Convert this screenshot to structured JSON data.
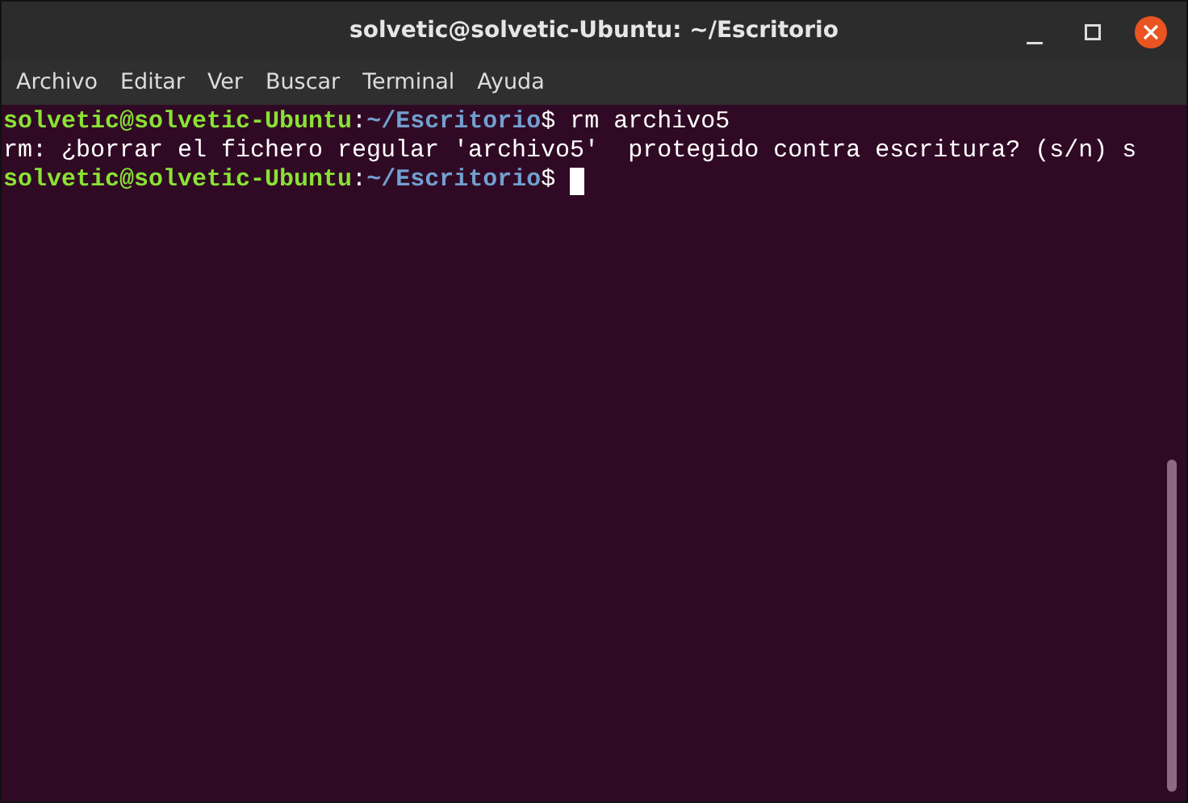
{
  "window": {
    "title": "solvetic@solvetic-Ubuntu: ~/Escritorio"
  },
  "menu": [
    "Archivo",
    "Editar",
    "Ver",
    "Buscar",
    "Terminal",
    "Ayuda"
  ],
  "terminal": {
    "lines": [
      {
        "cursor": false,
        "segments": [
          {
            "kind": "user",
            "text": "solvetic@solvetic-Ubuntu"
          },
          {
            "kind": "plain",
            "text": ":"
          },
          {
            "kind": "path",
            "text": "~/Escritorio"
          },
          {
            "kind": "plain",
            "text": "$ rm archivo5"
          }
        ]
      },
      {
        "cursor": false,
        "segments": [
          {
            "kind": "plain",
            "text": "rm: ¿borrar el fichero regular 'archivo5'  protegido contra escritura? (s/n) s"
          }
        ]
      },
      {
        "cursor": true,
        "segments": [
          {
            "kind": "user",
            "text": "solvetic@solvetic-Ubuntu"
          },
          {
            "kind": "plain",
            "text": ":"
          },
          {
            "kind": "path",
            "text": "~/Escritorio"
          },
          {
            "kind": "plain",
            "text": "$ "
          }
        ]
      }
    ]
  }
}
